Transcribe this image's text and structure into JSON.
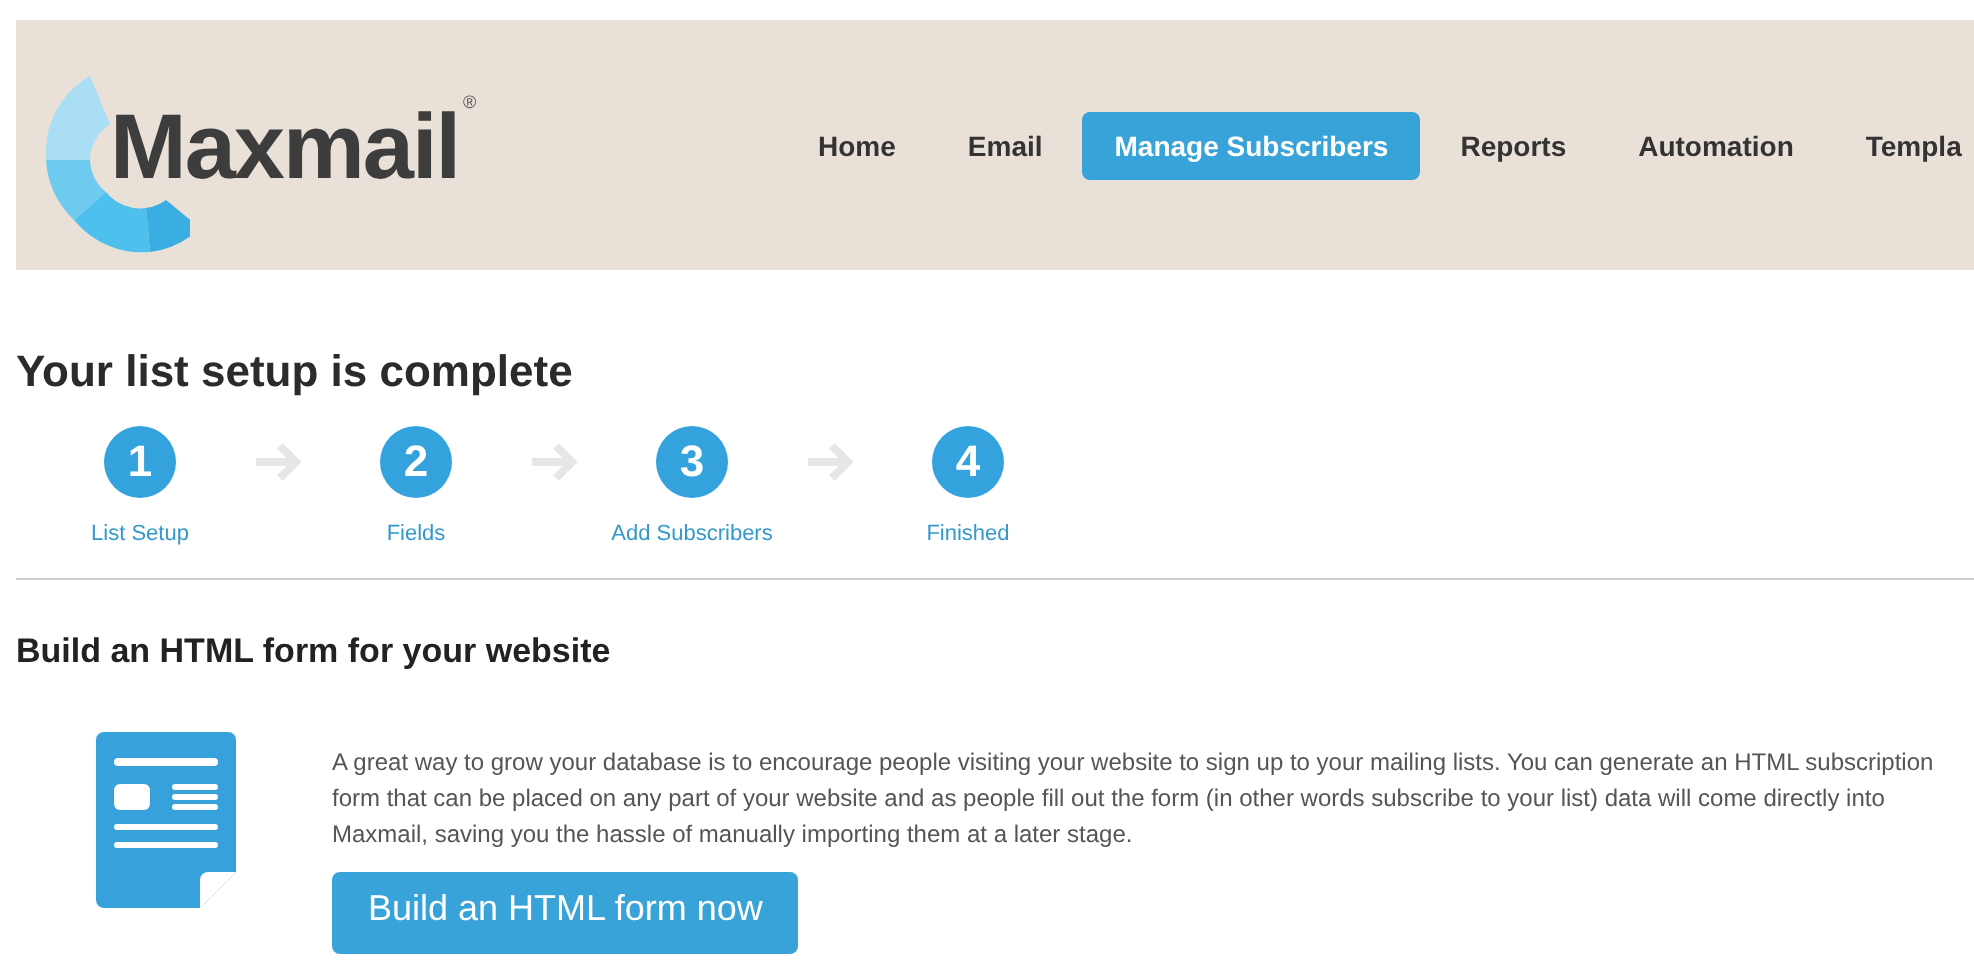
{
  "header": {
    "logo": {
      "text": "Maxmail",
      "mark": "®"
    },
    "nav": [
      {
        "label": "Home",
        "selected": false
      },
      {
        "label": "Email",
        "selected": false
      },
      {
        "label": "Manage Subscribers",
        "selected": true
      },
      {
        "label": "Reports",
        "selected": false
      },
      {
        "label": "Automation",
        "selected": false
      },
      {
        "label": "Templa",
        "selected": false
      }
    ]
  },
  "title": "Your list setup is complete",
  "steps": [
    {
      "number": "1",
      "label": "List Setup"
    },
    {
      "number": "2",
      "label": "Fields"
    },
    {
      "number": "3",
      "label": "Add Subscribers"
    },
    {
      "number": "4",
      "label": "Finished"
    }
  ],
  "section": {
    "heading": "Build an HTML form for your website",
    "text": "A great way to grow your database is to encourage people visiting your website to sign up to your mailing lists. You can generate an HTML subscription form that can be placed on any part of your website and as people fill out the form (in other words subscribe to your list) data will come directly into Maxmail, saving you the hassle of manually importing them at a later stage.",
    "button": "Build an HTML form now"
  }
}
